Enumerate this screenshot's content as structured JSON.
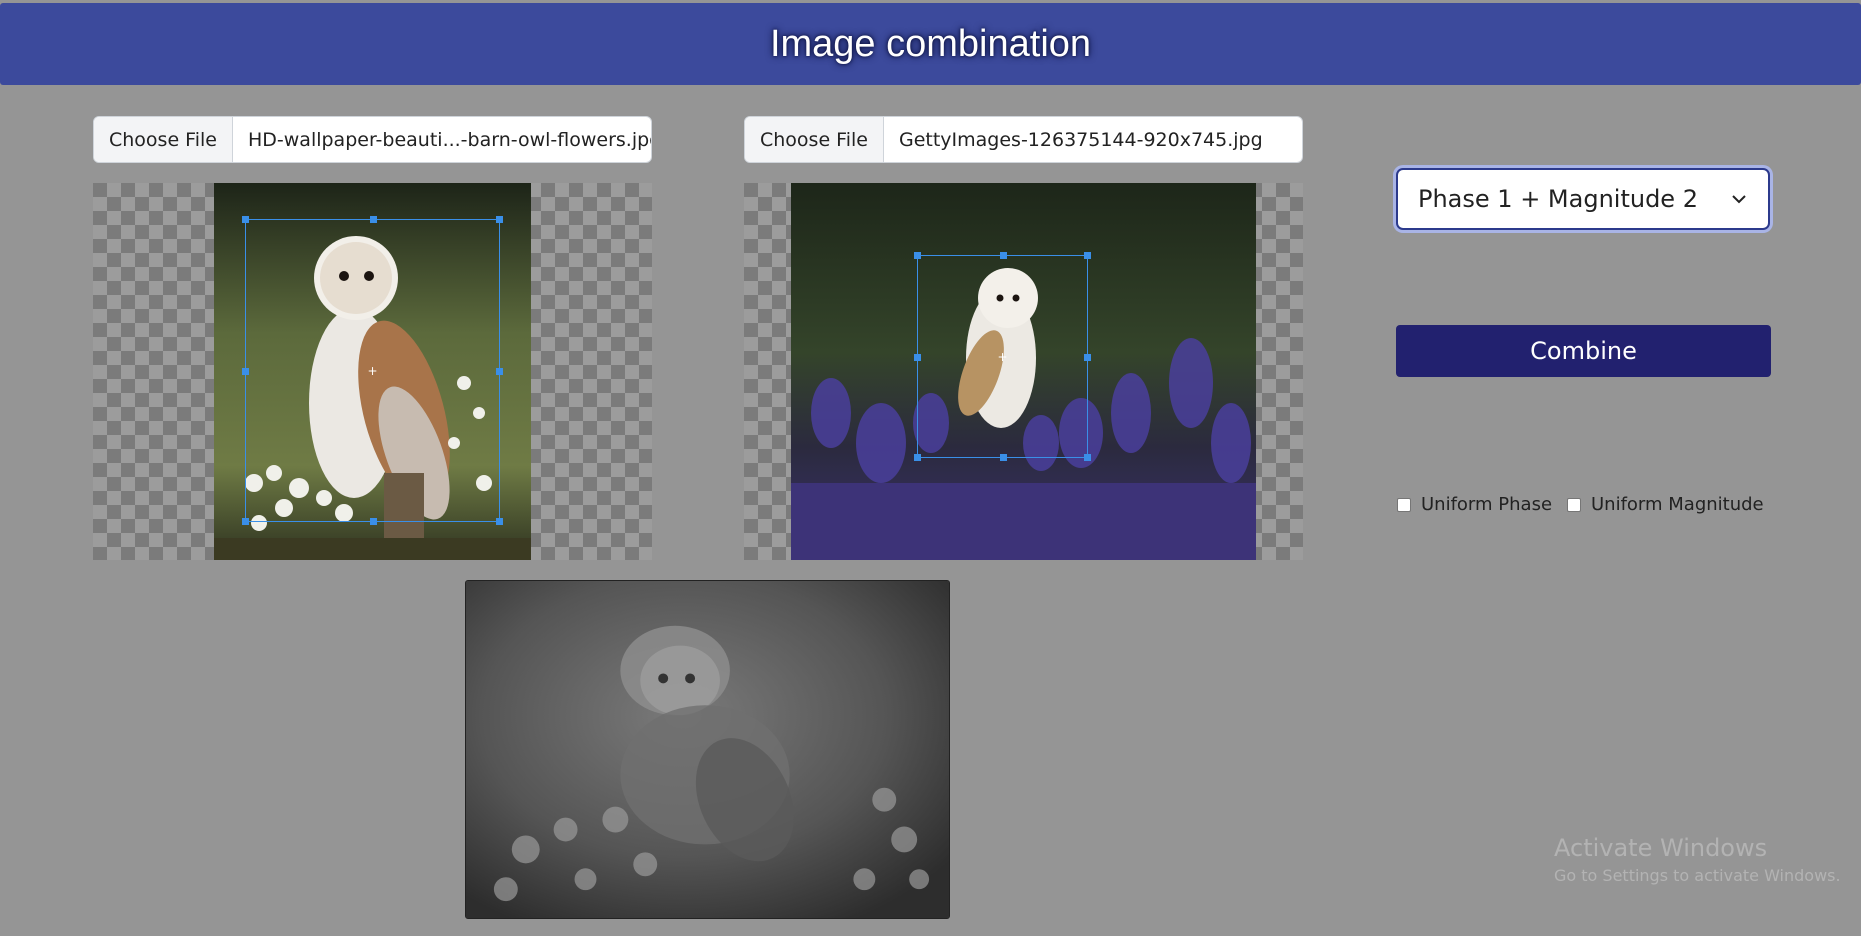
{
  "header": {
    "title": "Image combination"
  },
  "left_panel": {
    "choose_file_label": "Choose File",
    "file_name": "HD-wallpaper-beauti...-barn-owl-flowers.jpg"
  },
  "right_panel": {
    "choose_file_label": "Choose File",
    "file_name": "GettyImages-126375144-920x745.jpg"
  },
  "controls": {
    "mode_select": {
      "selected": "Phase 1 + Magnitude 2"
    },
    "combine_label": "Combine",
    "uniform_phase_label": "Uniform Phase",
    "uniform_magnitude_label": "Uniform Magnitude",
    "uniform_phase_checked": false,
    "uniform_magnitude_checked": false
  },
  "watermark": {
    "line1": "Activate Windows",
    "line2": "Go to Settings to activate Windows."
  },
  "colors": {
    "header": "#3c4a9c",
    "background": "#959595",
    "combine_button": "#22216f",
    "crop_outline": "#3a8fe8"
  }
}
